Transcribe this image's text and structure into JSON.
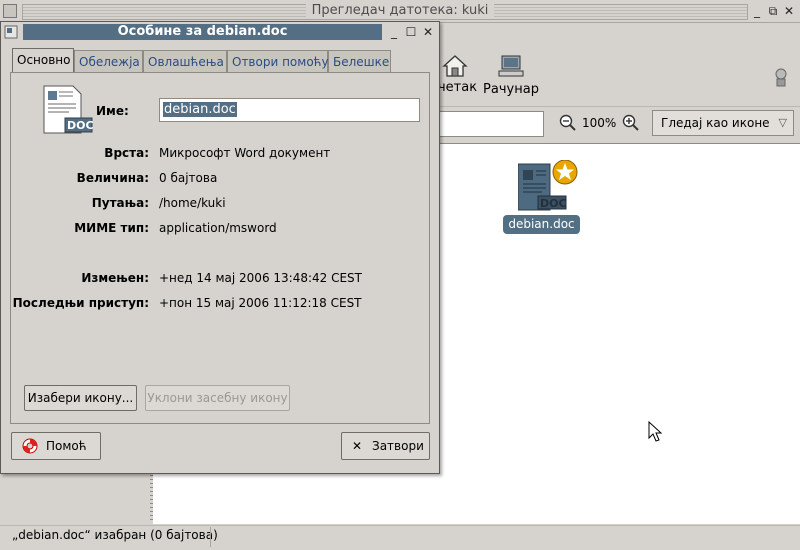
{
  "background_window": {
    "title": "Прегледач датотека: kuki",
    "toolbar": {
      "home_label": "Почетак",
      "home_label_visible": "четак",
      "computer_label": "Рачунар"
    },
    "zoom": {
      "level": "100%"
    },
    "view_select": {
      "selected": "Гледај као иконе"
    },
    "file": {
      "name": "debian.doc",
      "badge": "DOC"
    },
    "status": "„debian.doc“ изабран (0 бајтова)"
  },
  "dialog": {
    "title": "Особине за debian.doc",
    "tabs": [
      {
        "label": "Основно",
        "active": true
      },
      {
        "label": "Обележја",
        "active": false
      },
      {
        "label": "Овлашћења",
        "active": false
      },
      {
        "label": "Отвори помоћу",
        "active": false
      },
      {
        "label": "Белешке",
        "active": false
      }
    ],
    "name_label": "Име:",
    "name_value": "debian.doc",
    "icon_badge": "DOC",
    "fields": [
      {
        "label": "Врста:",
        "value": "Микрософт Word документ"
      },
      {
        "label": "Величина:",
        "value": "0 бајтова"
      },
      {
        "label": "Путања:",
        "value": "/home/kuki"
      },
      {
        "label": "МИМЕ тип:",
        "value": "application/msword"
      },
      {
        "label": "Измењен:",
        "value": "+нед 14 мај 2006 13:48:42 CEST"
      },
      {
        "label": "Последњи приступ:",
        "value": "+пон 15 мај 2006 11:12:18 CEST"
      }
    ],
    "buttons": {
      "choose_icon": "Изабери икону...",
      "remove_icon": "Уклони засебну икону",
      "help": "Помоћ",
      "close": "Затвори"
    }
  },
  "icons": {
    "file": "document-icon",
    "home": "home-icon",
    "computer": "computer-icon",
    "emblem": "star-emblem-icon"
  },
  "colors": {
    "selection": "#546e84",
    "link_tab": "#2b4a86"
  }
}
